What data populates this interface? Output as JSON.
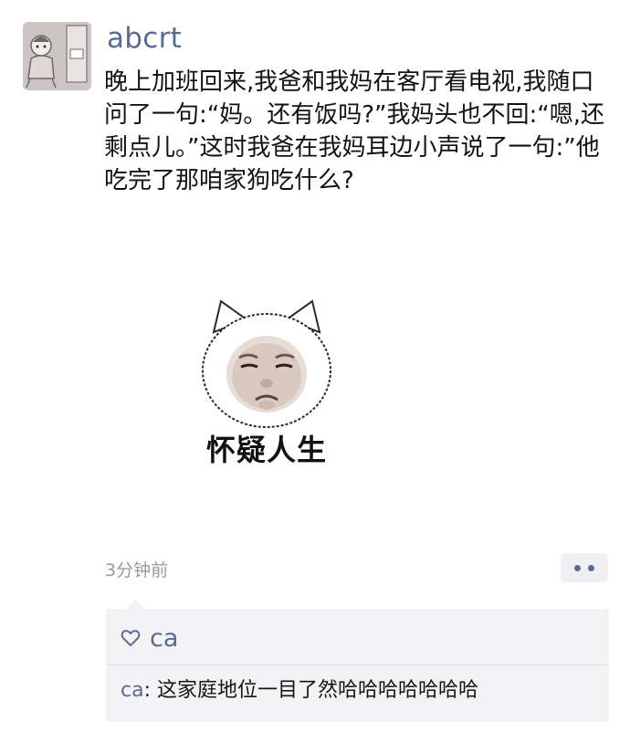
{
  "post": {
    "username": "abcrt",
    "text": "晚上加班回来,我爸和我妈在客厅看电视,我随口问了一句:“妈。还有饭吗?”我妈头也不回:“嗯,还剩点儿。”这时我爸在我妈耳边小声说了一句:”他吃完了那咱家狗吃什么?",
    "sticker_caption": "怀疑人生",
    "time": "3分钟前"
  },
  "likes": {
    "icon": "heart-outline-icon",
    "names": "ca"
  },
  "comments": [
    {
      "author": "ca",
      "separator": ": ",
      "text": "这家庭地位一目了然哈哈哈哈哈哈哈"
    }
  ],
  "colors": {
    "link": "#5b6b8f",
    "time": "#9a9a9a",
    "comment_bg": "#f3f3f5"
  }
}
